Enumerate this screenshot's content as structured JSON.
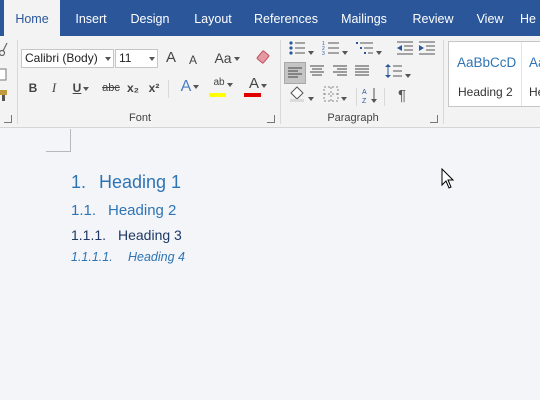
{
  "tabs": [
    "Home",
    "Insert",
    "Design",
    "Layout",
    "References",
    "Mailings",
    "Review",
    "View",
    "He"
  ],
  "active_tab": "Home",
  "font": {
    "name": "Calibri (Body)",
    "size": "11",
    "group_label": "Font",
    "bold": "B",
    "italic": "I",
    "underline": "U",
    "strike": "abc",
    "subscript": "x₂",
    "superscript": "x²",
    "grow": "A",
    "shrink": "A",
    "case": "Aa",
    "highlight_text": "ab",
    "font_color_text": "A",
    "text_effects": "A"
  },
  "paragraph": {
    "group_label": "Paragraph",
    "pilcrow": "¶"
  },
  "styles": {
    "preview": "AaBbCcD",
    "name": "Heading 2",
    "preview2": "Aa",
    "name2": "He"
  },
  "colors": {
    "ribbon_blue": "#2b579a",
    "highlight": "#ffff00",
    "font_color": "#e00000",
    "heading": "#2e74b5"
  },
  "document": {
    "headings": [
      {
        "num": "1.",
        "text": "Heading 1"
      },
      {
        "num": "1.1.",
        "text": "Heading 2"
      },
      {
        "num": "1.1.1.",
        "text": "Heading 3"
      },
      {
        "num": "1.1.1.1.",
        "text": "Heading 4"
      }
    ]
  }
}
